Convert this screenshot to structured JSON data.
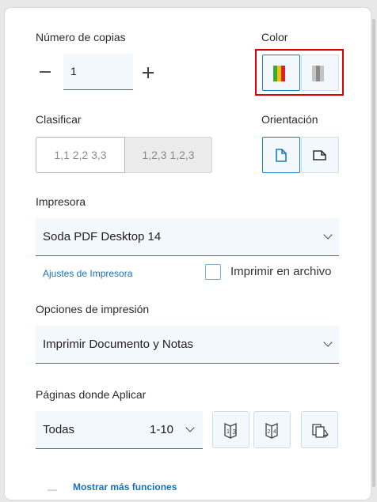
{
  "copies": {
    "label": "Número de copias",
    "value": "1"
  },
  "color": {
    "label": "Color",
    "options": [
      "color-icon",
      "grayscale-icon"
    ],
    "colors": {
      "red": "#e02020",
      "yellow": "#f2c200",
      "green": "#3aaa35",
      "gray_dark": "#8a8a8a",
      "gray_light": "#c4c4c4"
    }
  },
  "collate": {
    "label": "Clasificar",
    "option1": "1,1 2,2 3,3",
    "option2": "1,2,3 1,2,3"
  },
  "orientation": {
    "label": "Orientación",
    "options": [
      "portrait-icon",
      "landscape-icon"
    ]
  },
  "printer": {
    "label": "Impresora",
    "value": "Soda PDF Desktop 14",
    "settings_link": "Ajustes de Impresora",
    "print_to_file": "Imprimir en archivo"
  },
  "print_options": {
    "label": "Opciones de impresión",
    "value": "Imprimir Documento y Notas"
  },
  "pages": {
    "label": "Páginas donde Aplicar",
    "value": "Todas",
    "range": "1-10",
    "buttons": [
      "odd-pages-icon",
      "even-pages-icon",
      "reverse-pages-icon"
    ]
  },
  "more": {
    "label": "Mostrar más funciones"
  },
  "accent": "#1a7bc4"
}
